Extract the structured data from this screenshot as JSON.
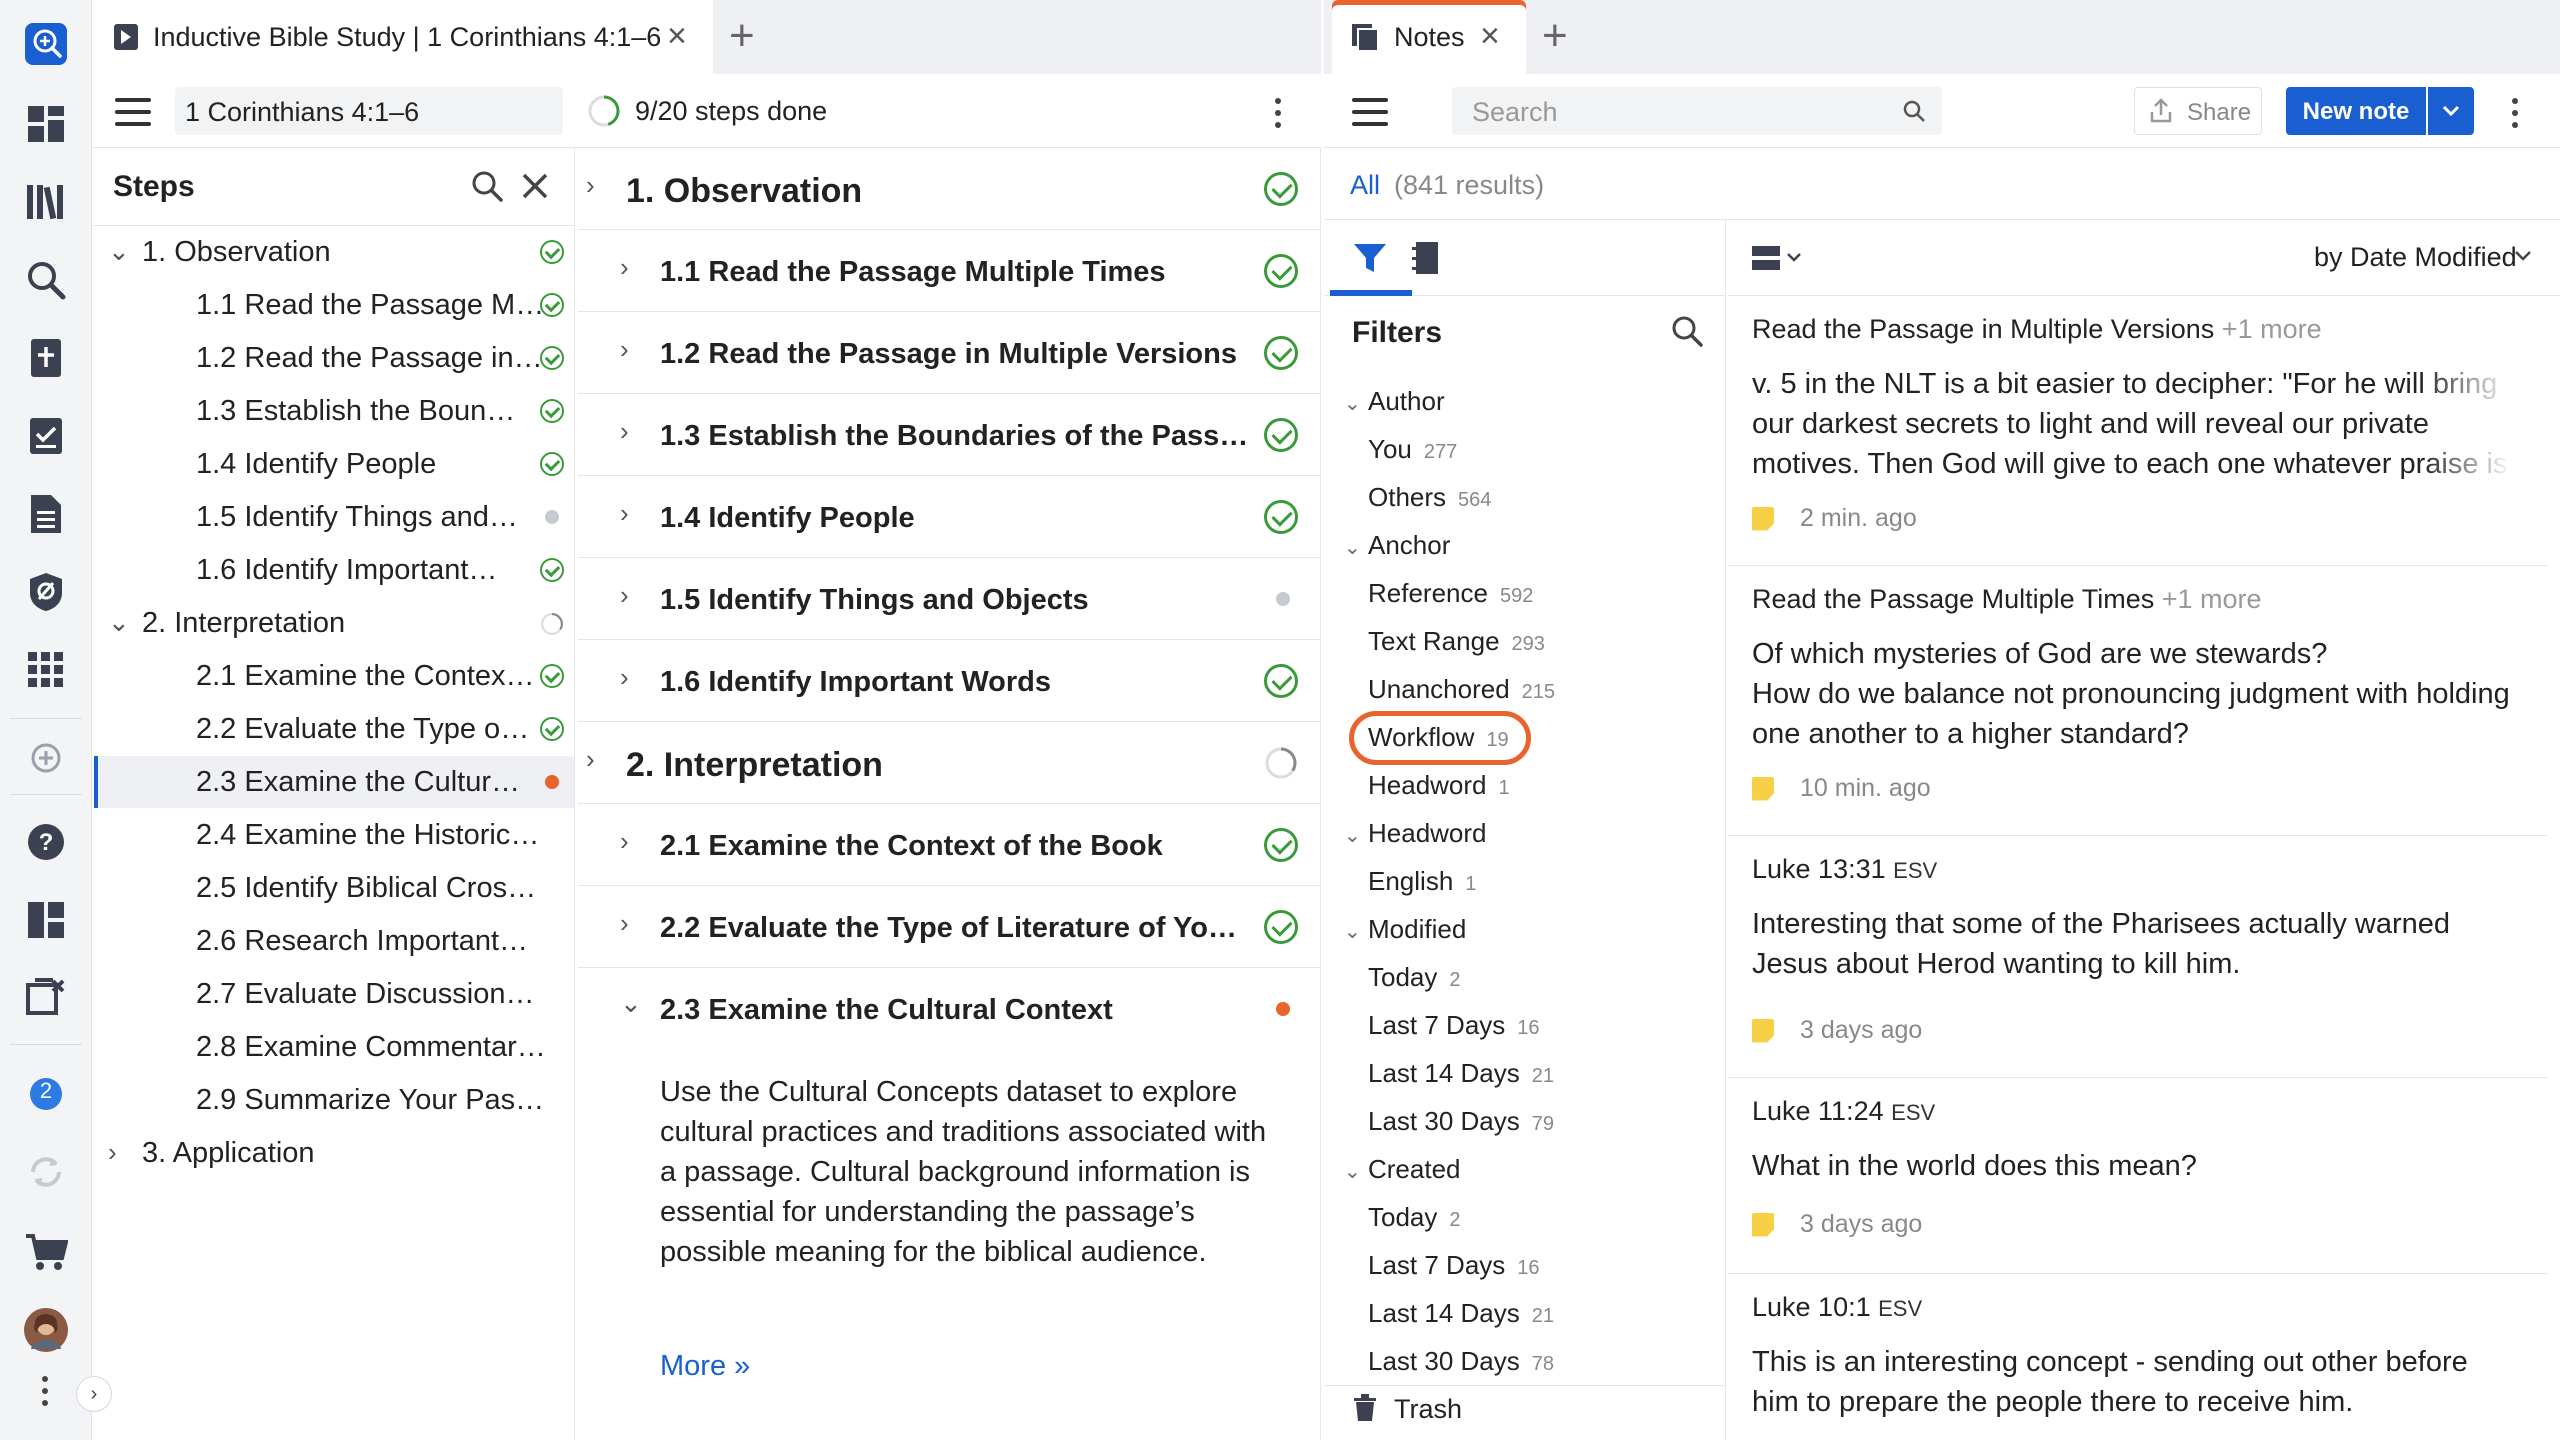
{
  "rail": {
    "icons": [
      "search-bible-icon",
      "dashboard-icon",
      "library-icon",
      "search-icon",
      "add-book-icon",
      "checklist-icon",
      "document-icon",
      "shield-icon",
      "apps-icon",
      "add-circle-icon",
      "help-icon",
      "layout-icon",
      "close-panels-icon",
      "sync-icon",
      "cart-icon",
      "avatar",
      "more-icon"
    ],
    "badge": "2"
  },
  "left_tab": {
    "title": "Inductive Bible Study | 1 Corinthians 4:1–6",
    "reference": "1 Corinthians 4:1–6",
    "progress": "9/20 steps done",
    "progress_fraction": 0.45
  },
  "steps_sidebar": {
    "title": "Steps",
    "groups": [
      {
        "label": "1. Observation",
        "status": "done",
        "expanded": true,
        "items": [
          {
            "label": "1.1 Read the Passage M…",
            "status": "done"
          },
          {
            "label": "1.2 Read the Passage in…",
            "status": "done"
          },
          {
            "label": "1.3 Establish the Boun…",
            "status": "done"
          },
          {
            "label": "1.4 Identify People",
            "status": "done"
          },
          {
            "label": "1.5 Identify Things and…",
            "status": "todo"
          },
          {
            "label": "1.6 Identify Important…",
            "status": "done"
          }
        ]
      },
      {
        "label": "2. Interpretation",
        "status": "partial",
        "expanded": true,
        "items": [
          {
            "label": "2.1 Examine the Contex…",
            "status": "done"
          },
          {
            "label": "2.2 Evaluate the Type o…",
            "status": "done"
          },
          {
            "label": "2.3 Examine the Cultur…",
            "status": "current"
          },
          {
            "label": "2.4 Examine the Historica…",
            "status": "none"
          },
          {
            "label": "2.5 Identify Biblical Cross…",
            "status": "none"
          },
          {
            "label": "2.6 Research Important…",
            "status": "none"
          },
          {
            "label": "2.7 Evaluate Discussions…",
            "status": "none"
          },
          {
            "label": "2.8 Examine Commentar…",
            "status": "none"
          },
          {
            "label": "2.9 Summarize Your Pass…",
            "status": "none"
          }
        ]
      },
      {
        "label": "3. Application",
        "status": "none",
        "expanded": false,
        "items": []
      }
    ]
  },
  "main_steps": {
    "rows": [
      {
        "label": "1. Observation",
        "level": 1,
        "status": "done"
      },
      {
        "label": "1.1 Read the Passage Multiple Times",
        "level": 2,
        "status": "done"
      },
      {
        "label": "1.2 Read the Passage in Multiple Versions",
        "level": 2,
        "status": "done"
      },
      {
        "label": "1.3 Establish the Boundaries of the Passage",
        "level": 2,
        "status": "done"
      },
      {
        "label": "1.4 Identify People",
        "level": 2,
        "status": "done"
      },
      {
        "label": "1.5 Identify Things and Objects",
        "level": 2,
        "status": "todo"
      },
      {
        "label": "1.6 Identify Important Words",
        "level": 2,
        "status": "done"
      },
      {
        "label": "2. Interpretation",
        "level": 1,
        "status": "partial"
      },
      {
        "label": "2.1 Examine the Context of the Book",
        "level": 2,
        "status": "done"
      },
      {
        "label": "2.2 Evaluate the Type of Literature of Your…",
        "level": 2,
        "status": "done"
      },
      {
        "label": "2.3 Examine the Cultural Context",
        "level": 2,
        "status": "current"
      }
    ],
    "expanded_description": "Use the Cultural Concepts dataset to explore cultural practices and traditions associated with a passage. Cultural background information is essential for understanding the passage’s possible meaning for the biblical audience.",
    "more_link": "More »"
  },
  "notes_tab": {
    "title": "Notes",
    "search_placeholder": "Search",
    "share_label": "Share",
    "new_note_label": "New note",
    "results_all": "All",
    "results_count": "(841 results)",
    "sort_label": "by Date Modified"
  },
  "filters": {
    "title": "Filters",
    "groups": [
      {
        "label": "Author",
        "items": [
          {
            "label": "You",
            "count": "277"
          },
          {
            "label": "Others",
            "count": "564"
          }
        ]
      },
      {
        "label": "Anchor",
        "items": [
          {
            "label": "Reference",
            "count": "592"
          },
          {
            "label": "Text Range",
            "count": "293"
          },
          {
            "label": "Unanchored",
            "count": "215"
          },
          {
            "label": "Workflow",
            "count": "19"
          },
          {
            "label": "Headword",
            "count": "1"
          }
        ]
      },
      {
        "label": "Headword",
        "items": [
          {
            "label": "English",
            "count": "1"
          }
        ]
      },
      {
        "label": "Modified",
        "items": [
          {
            "label": "Today",
            "count": "2"
          },
          {
            "label": "Last 7 Days",
            "count": "16"
          },
          {
            "label": "Last 14 Days",
            "count": "21"
          },
          {
            "label": "Last 30 Days",
            "count": "79"
          }
        ]
      },
      {
        "label": "Created",
        "items": [
          {
            "label": "Today",
            "count": "2"
          },
          {
            "label": "Last 7 Days",
            "count": "16"
          },
          {
            "label": "Last 14 Days",
            "count": "21"
          },
          {
            "label": "Last 30 Days",
            "count": "78"
          }
        ]
      }
    ],
    "trash_label": "Trash",
    "highlighted": "Workflow"
  },
  "notes": [
    {
      "title": "Read the Passage in Multiple Versions",
      "more": "+1 more",
      "version": "",
      "body": "v. 5 in the NLT is a bit easier to decipher: \"For he will bring our darkest secrets to light and will reveal our private motives. Then God will give to each one whatever praise is",
      "time": "2 min. ago"
    },
    {
      "title": "Read the Passage Multiple Times",
      "more": "+1 more",
      "version": "",
      "body": "Of which mysteries of God are we stewards?\nHow do we balance not pronouncing judgment with holding one another to a higher standard?",
      "time": "10 min. ago"
    },
    {
      "title": "Luke 13:31",
      "more": "",
      "version": "ESV",
      "body": "Interesting that some of the Pharisees actually warned Jesus about Herod wanting to kill him.",
      "time": "3 days ago"
    },
    {
      "title": "Luke 11:24",
      "more": "",
      "version": "ESV",
      "body": "What in the world does this mean?",
      "time": "3 days ago"
    },
    {
      "title": "Luke 10:1",
      "more": "",
      "version": "ESV",
      "body": "This is an interesting concept - sending out other before him to prepare the people there to receive him.",
      "time": ""
    }
  ],
  "colors": {
    "accent_blue": "#1a5fd1",
    "check_green": "#3a9a3a",
    "current_orange": "#e8642c",
    "highlight_ring": "#e8642c"
  }
}
